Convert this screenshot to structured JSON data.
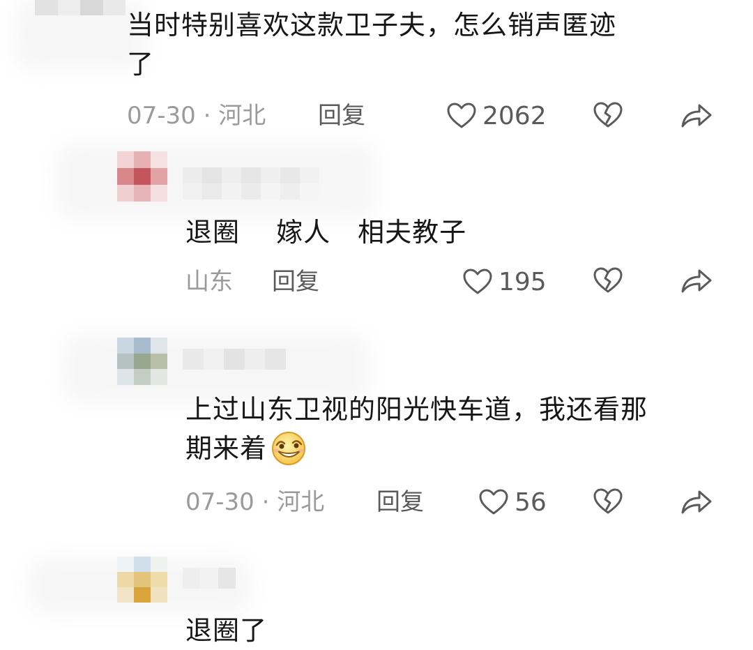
{
  "comments": [
    {
      "text_lines": [
        "当时特别喜欢这款卫子夫，怎么销声匿迹",
        "了"
      ],
      "meta": "07-30 · 河北",
      "reply_label": "回复",
      "likes": "2062"
    },
    {
      "text_lines": [
        "退圈　  嫁人　相夫教子"
      ],
      "meta": "山东",
      "reply_label": "回复",
      "likes": "195"
    },
    {
      "text_lines": [
        "上过山东卫视的阳光快车道，我还看那",
        "期来着"
      ],
      "meta": "07-30 · 河北",
      "reply_label": "回复",
      "likes": "56",
      "emoji": "grinning-face-emoji"
    },
    {
      "text_lines": [
        "退圈了"
      ]
    }
  ],
  "icons": {
    "like": "heart-outline-icon",
    "dislike": "broken-heart-icon",
    "share": "share-arrow-icon"
  },
  "colors": {
    "text": "#161616",
    "meta": "#9a9a9a",
    "action": "#5a5a5a"
  }
}
